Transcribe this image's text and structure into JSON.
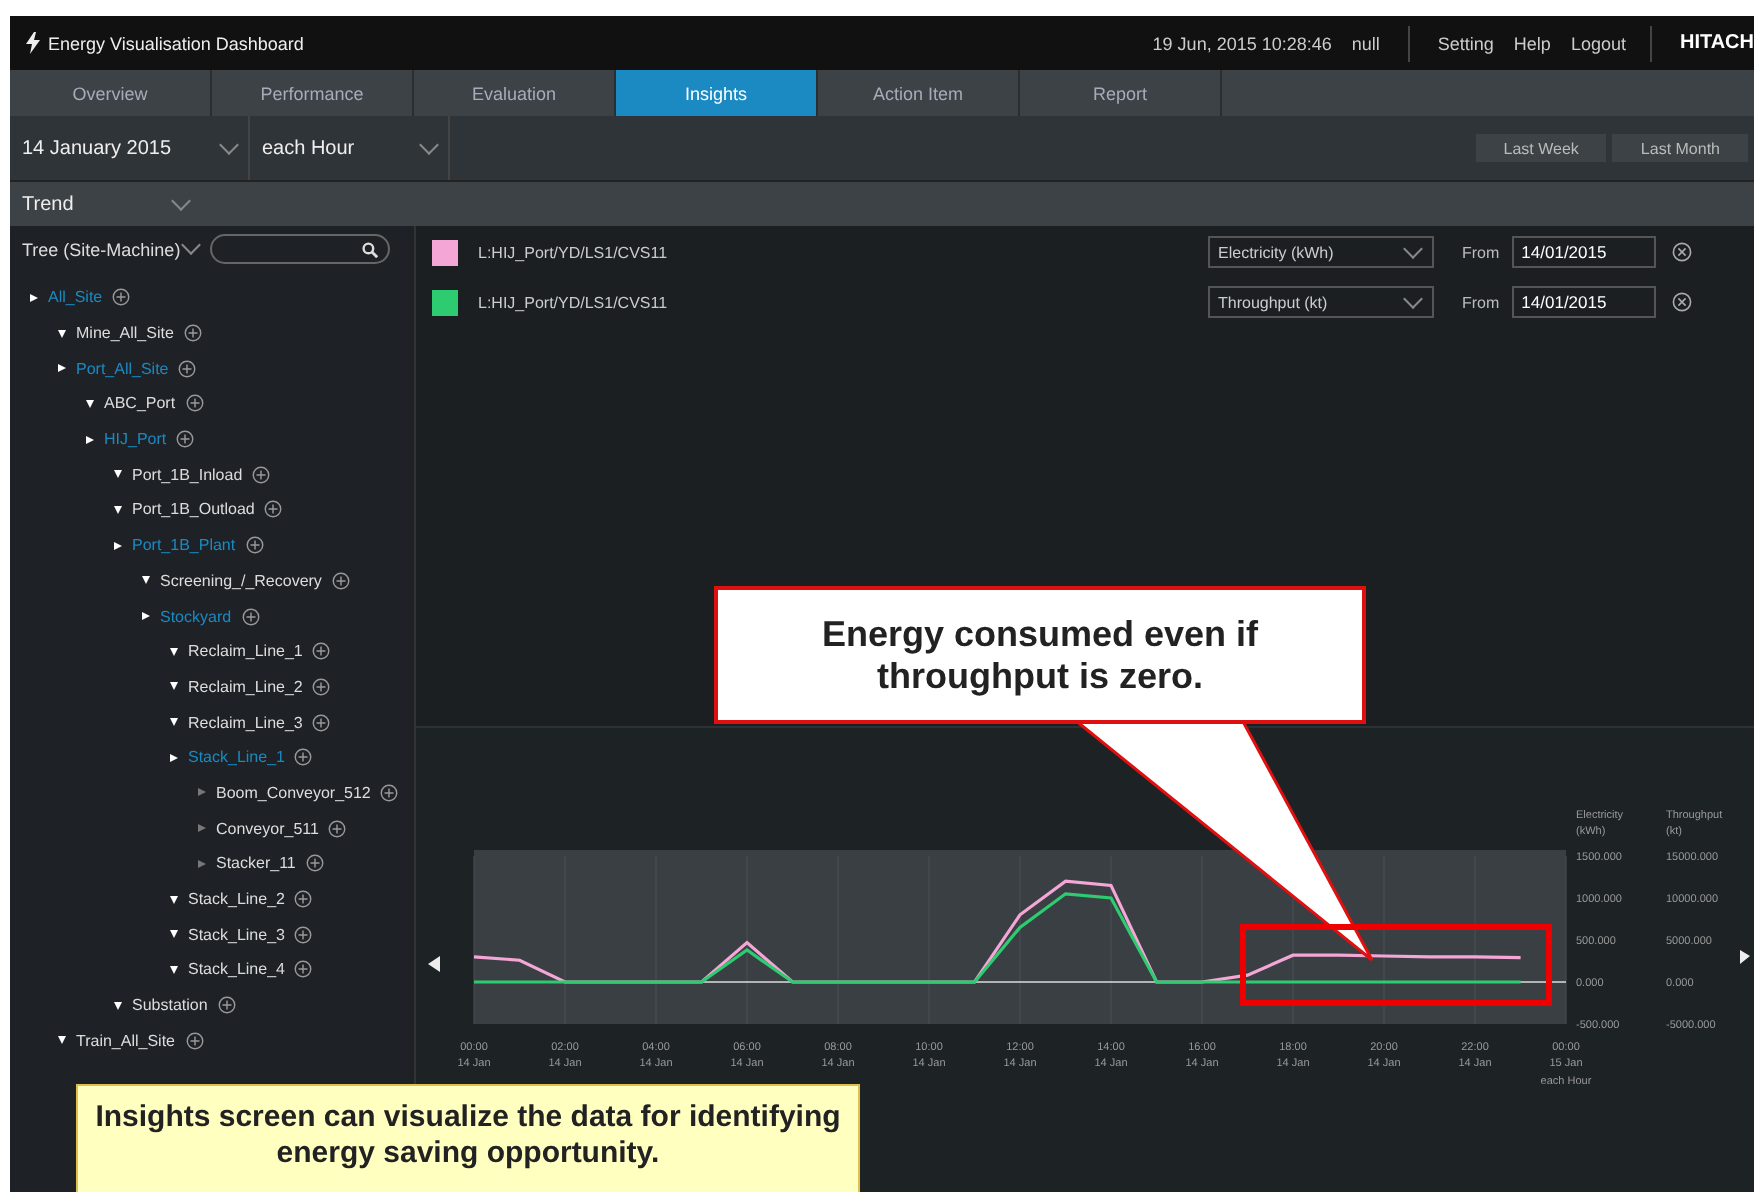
{
  "header": {
    "title": "Energy Visualisation Dashboard",
    "datetime": "19 Jun, 2015 10:28:46",
    "user": "null",
    "links": [
      "Setting",
      "Help",
      "Logout"
    ],
    "brand": "HITACH"
  },
  "tabs": [
    {
      "label": "Overview",
      "selected": false
    },
    {
      "label": "Performance",
      "selected": false
    },
    {
      "label": "Evaluation",
      "selected": false
    },
    {
      "label": "Insights",
      "selected": true
    },
    {
      "label": "Action Item",
      "selected": false
    },
    {
      "label": "Report",
      "selected": false
    }
  ],
  "filter_bar": {
    "date": "14 January 2015",
    "interval": "each Hour",
    "buttons": [
      "Last Week",
      "Last Month"
    ]
  },
  "view_selector": {
    "value": "Trend"
  },
  "sidebar": {
    "tree_selector": "Tree (Site-Machine)",
    "tree": [
      {
        "label": "All_Site",
        "highlighted": true,
        "expanded": false,
        "children": [
          {
            "label": "Mine_All_Site",
            "highlighted": false,
            "expanded": true
          },
          {
            "label": "Port_All_Site",
            "highlighted": true,
            "expanded": false,
            "children": [
              {
                "label": "ABC_Port",
                "highlighted": false,
                "expanded": true
              },
              {
                "label": "HIJ_Port",
                "highlighted": true,
                "expanded": false,
                "children": [
                  {
                    "label": "Port_1B_Inload",
                    "highlighted": false,
                    "expanded": true
                  },
                  {
                    "label": "Port_1B_Outload",
                    "highlighted": false,
                    "expanded": true
                  },
                  {
                    "label": "Port_1B_Plant",
                    "highlighted": true,
                    "expanded": false,
                    "children": [
                      {
                        "label": "Screening_/_Recovery",
                        "highlighted": false,
                        "expanded": true
                      },
                      {
                        "label": "Stockyard",
                        "highlighted": true,
                        "expanded": false,
                        "children": [
                          {
                            "label": "Reclaim_Line_1",
                            "highlighted": false,
                            "expanded": true
                          },
                          {
                            "label": "Reclaim_Line_2",
                            "highlighted": false,
                            "expanded": true
                          },
                          {
                            "label": "Reclaim_Line_3",
                            "highlighted": false,
                            "expanded": true
                          },
                          {
                            "label": "Stack_Line_1",
                            "highlighted": true,
                            "expanded": false,
                            "children": [
                              {
                                "label": "Boom_Conveyor_512",
                                "highlighted": false,
                                "expanded": false
                              },
                              {
                                "label": "Conveyor_511",
                                "highlighted": false,
                                "expanded": false
                              },
                              {
                                "label": "Stacker_11",
                                "highlighted": false,
                                "expanded": false
                              }
                            ]
                          },
                          {
                            "label": "Stack_Line_2",
                            "highlighted": false,
                            "expanded": true
                          },
                          {
                            "label": "Stack_Line_3",
                            "highlighted": false,
                            "expanded": true
                          },
                          {
                            "label": "Stack_Line_4",
                            "highlighted": false,
                            "expanded": true
                          }
                        ]
                      }
                    ]
                  },
                  {
                    "label": "Substation",
                    "highlighted": false,
                    "expanded": true
                  }
                ]
              }
            ]
          },
          {
            "label": "Train_All_Site",
            "highlighted": false,
            "expanded": true
          }
        ]
      }
    ]
  },
  "legend": [
    {
      "color": "#f4a6d7",
      "path": "L:HIJ_Port/YD/LS1/CVS11",
      "measure": "Electricity (kWh)",
      "from_label": "From",
      "from": "14/01/2015"
    },
    {
      "color": "#2ecc71",
      "path": "L:HIJ_Port/YD/LS1/CVS11",
      "measure": "Throughput (kt)",
      "from_label": "From",
      "from": "14/01/2015"
    }
  ],
  "chart": {
    "xtick_dates": [
      "14 Jan",
      "14 Jan",
      "14 Jan",
      "14 Jan",
      "14 Jan",
      "14 Jan",
      "14 Jan",
      "14 Jan",
      "14 Jan",
      "14 Jan",
      "14 Jan",
      "14 Jan",
      "15 Jan"
    ],
    "charts": [
      {
        "chart_data": {
          "type": "line",
          "xlabel": "each Hour",
          "grid": true,
          "x": [
            0,
            1,
            2,
            3,
            4,
            5,
            6,
            7,
            8,
            9,
            10,
            11,
            12,
            13,
            14,
            15,
            16,
            17,
            18,
            19,
            20,
            21,
            22,
            23
          ],
          "series": [
            {
              "name": "Electricity (kWh)",
              "color": "#f4a6d7",
              "values": [
                300,
                260,
                0,
                0,
                0,
                0,
                470,
                0,
                0,
                0,
                0,
                0,
                800,
                1200,
                1150,
                0,
                0,
                80,
                320,
                320,
                310,
                300,
                300,
                290
              ]
            }
          ],
          "xlim": [
            0,
            24
          ],
          "ylim": [
            -500,
            1500
          ],
          "xticks": [
            {
              "value": 0,
              "label": "00:00"
            },
            {
              "value": 2,
              "label": "02:00"
            },
            {
              "value": 4,
              "label": "04:00"
            },
            {
              "value": 6,
              "label": "06:00"
            },
            {
              "value": 8,
              "label": "08:00"
            },
            {
              "value": 10,
              "label": "10:00"
            },
            {
              "value": 12,
              "label": "12:00"
            },
            {
              "value": 14,
              "label": "14:00"
            },
            {
              "value": 16,
              "label": "16:00"
            },
            {
              "value": 18,
              "label": "18:00"
            },
            {
              "value": 20,
              "label": "20:00"
            },
            {
              "value": 22,
              "label": "22:00"
            },
            {
              "value": 24,
              "label": "00:00"
            }
          ],
          "yticks": [
            {
              "value": 1500,
              "label": "1500.000"
            },
            {
              "value": 1000,
              "label": "1000.000"
            },
            {
              "value": 500,
              "label": "500.000"
            },
            {
              "value": 0,
              "label": "0.000"
            },
            {
              "value": -500,
              "label": "-500.000"
            }
          ]
        }
      },
      {
        "chart_data": {
          "type": "line",
          "x": [
            0,
            1,
            2,
            3,
            4,
            5,
            6,
            7,
            8,
            9,
            10,
            11,
            12,
            13,
            14,
            15,
            16,
            17,
            18,
            19,
            20,
            21,
            22,
            23
          ],
          "series": [
            {
              "name": "Throughput (kt)",
              "color": "#2ecc71",
              "values": [
                0,
                0,
                0,
                0,
                0,
                0,
                3800,
                0,
                0,
                0,
                0,
                0,
                6500,
                10500,
                10000,
                0,
                0,
                0,
                0,
                0,
                0,
                0,
                0,
                0
              ]
            }
          ],
          "xlim": [
            0,
            24
          ],
          "ylim": [
            -5000,
            15000
          ],
          "yticks": [
            {
              "value": 15000,
              "label": "15000.000"
            },
            {
              "value": 10000,
              "label": "10000.000"
            },
            {
              "value": 5000,
              "label": "5000.000"
            },
            {
              "value": 0,
              "label": "0.000"
            },
            {
              "value": -5000,
              "label": "-5000.000"
            }
          ]
        }
      }
    ]
  },
  "callouts": [
    {
      "kind": "bubble",
      "text": "Energy consumed even if throughput is zero."
    },
    {
      "kind": "note",
      "text": "Insights screen can visualize the data for identifying energy saving opportunity."
    }
  ]
}
